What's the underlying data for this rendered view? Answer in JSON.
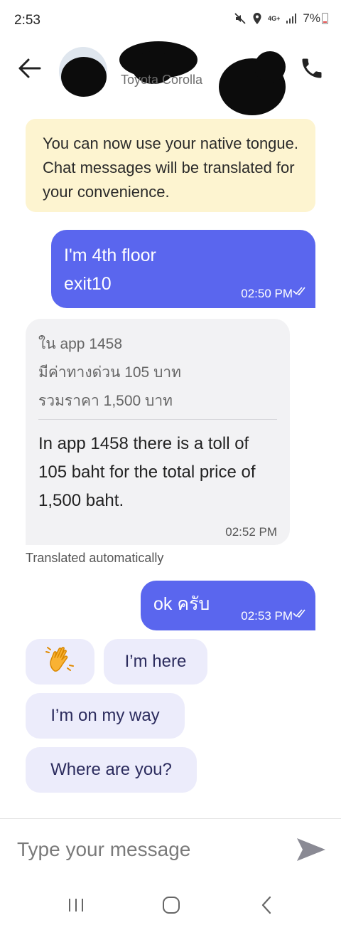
{
  "status_bar": {
    "time": "2:53",
    "network": "4G+",
    "battery": "7%",
    "icons": [
      "mute-icon",
      "location-icon",
      "network-icon",
      "signal-icon",
      "battery-icon"
    ]
  },
  "header": {
    "vehicle": "Toyota Corolla",
    "icons": [
      "back-arrow-icon",
      "phone-icon"
    ]
  },
  "banner": {
    "text": "You can now use your native tongue. Chat messages will be translated for your convenience."
  },
  "messages": [
    {
      "direction": "outgoing",
      "lines": [
        "I'm 4th floor",
        "exit10"
      ],
      "time": "02:50 PM",
      "read_icon": "double-check-icon"
    },
    {
      "direction": "incoming",
      "original_lines": [
        "ใน app 1458",
        "มีค่าทางด่วน 105 บาท",
        "รวมราคา 1,500 บาท"
      ],
      "translated": "In app 1458 there is a toll of 105 baht for the total price of 1,500 baht.",
      "time": "02:52 PM",
      "note": "Translated automatically"
    },
    {
      "direction": "outgoing",
      "lines": [
        "ok ครับ"
      ],
      "time": "02:53 PM",
      "read_icon": "double-check-icon"
    }
  ],
  "quick_replies": {
    "wave_icon": "waving-hand-icon",
    "items": [
      "I’m here",
      "I’m on my way",
      "Where are you?"
    ]
  },
  "composer": {
    "placeholder": "Type your message",
    "send_icon": "send-icon"
  },
  "nav_bar": {
    "icons": [
      "recent-apps-icon",
      "home-icon",
      "back-icon"
    ]
  },
  "colors": {
    "accent": "#5a66ee",
    "banner_bg": "#fdf4d0",
    "incoming_bg": "#f2f2f4",
    "chip_bg": "#ececfb"
  }
}
